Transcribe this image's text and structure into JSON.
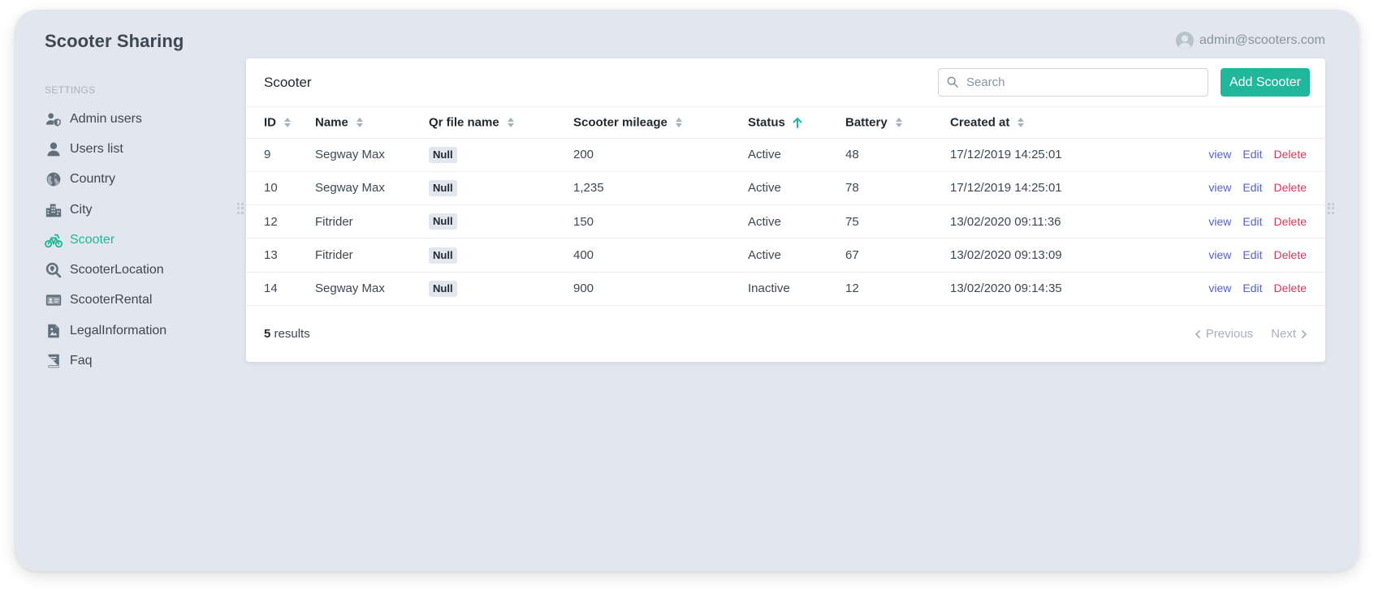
{
  "app": {
    "title": "Scooter Sharing"
  },
  "user": {
    "email": "admin@scooters.com",
    "icon": "user-circle-icon"
  },
  "sidebar": {
    "section": "SETTINGS",
    "items": [
      {
        "label": "Admin users",
        "icon": "user-shield-icon"
      },
      {
        "label": "Users list",
        "icon": "user-icon"
      },
      {
        "label": "Country",
        "icon": "globe-icon"
      },
      {
        "label": "City",
        "icon": "city-icon"
      },
      {
        "label": "Scooter",
        "icon": "scooter-icon",
        "active": true
      },
      {
        "label": "ScooterLocation",
        "icon": "search-location-icon"
      },
      {
        "label": "ScooterRental",
        "icon": "id-card-icon"
      },
      {
        "label": "LegalInformation",
        "icon": "document-icon"
      },
      {
        "label": "Faq",
        "icon": "book-icon"
      }
    ]
  },
  "card": {
    "title": "Scooter",
    "search_placeholder": "Search",
    "add_button": "Add Scooter"
  },
  "table": {
    "columns": [
      "ID",
      "Name",
      "Qr file name",
      "Scooter mileage",
      "Status",
      "Battery",
      "Created at"
    ],
    "sorted_column": "Status",
    "rows": [
      {
        "id": "9",
        "name": "Segway Max",
        "qr": "Null",
        "mileage": "200",
        "status": "Active",
        "battery": "48",
        "created": "17/12/2019 14:25:01"
      },
      {
        "id": "10",
        "name": "Segway Max",
        "qr": "Null",
        "mileage": "1,235",
        "status": "Active",
        "battery": "78",
        "created": "17/12/2019 14:25:01"
      },
      {
        "id": "12",
        "name": "Fitrider",
        "qr": "Null",
        "mileage": "150",
        "status": "Active",
        "battery": "75",
        "created": "13/02/2020 09:11:36"
      },
      {
        "id": "13",
        "name": "Fitrider",
        "qr": "Null",
        "mileage": "400",
        "status": "Active",
        "battery": "67",
        "created": "13/02/2020 09:13:09"
      },
      {
        "id": "14",
        "name": "Segway Max",
        "qr": "Null",
        "mileage": "900",
        "status": "Inactive",
        "battery": "12",
        "created": "13/02/2020 09:14:35"
      }
    ],
    "actions": {
      "view": "view",
      "edit": "Edit",
      "delete": "Delete"
    }
  },
  "footer": {
    "count": "5",
    "results_label": " results",
    "previous": "Previous",
    "next": "Next"
  },
  "colors": {
    "accent": "#21b79a",
    "link": "#5561c9",
    "danger": "#d6375a",
    "background": "#e2e6ee"
  }
}
